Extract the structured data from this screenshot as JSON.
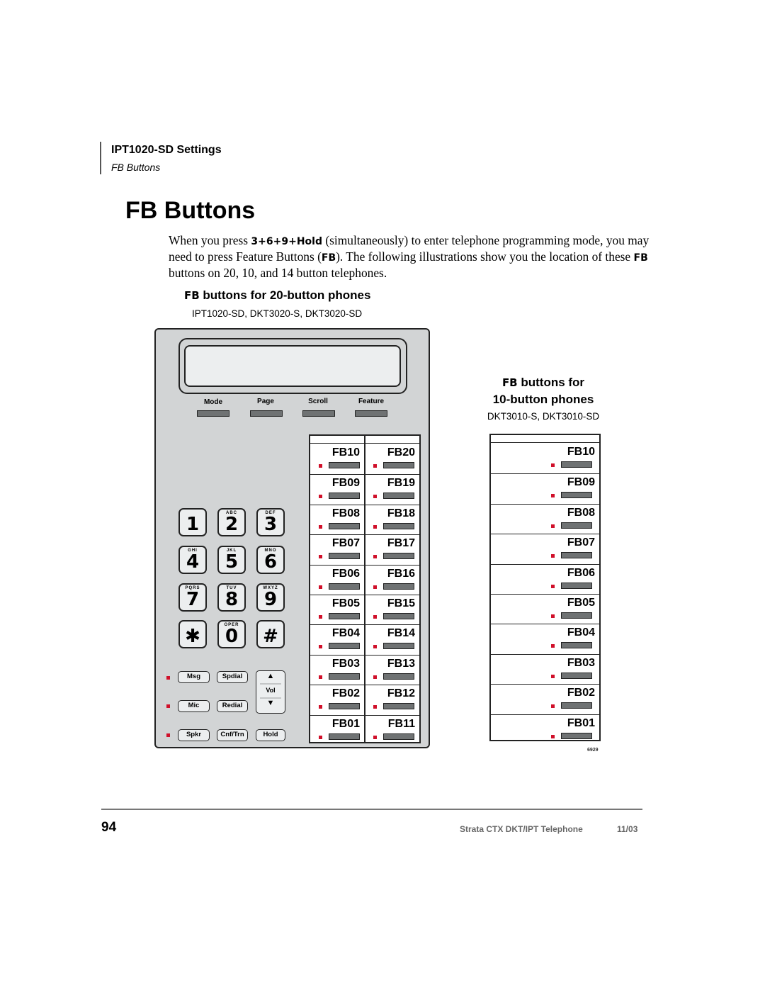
{
  "header": {
    "section": "IPT1020-SD Settings",
    "subsection": "FB Buttons"
  },
  "title": "FB Buttons",
  "body": {
    "p1_a": "When you press ",
    "p1_keys": "3+6+9+Hold",
    "p1_b": " (simultaneously) to enter telephone programming mode, you may need to press Feature Buttons (",
    "p1_fb": "FB",
    "p1_c": "). The following illustrations show you the location of these ",
    "p1_fb2": "FB",
    "p1_d": " buttons on 20, 10, and 14 button telephones."
  },
  "figure20": {
    "heading_fb": "FB",
    "heading_rest": " buttons for 20-button phones",
    "models": "IPT1020-SD, DKT3020-S, DKT3020-SD",
    "soft_keys": [
      "Mode",
      "Page",
      "Scroll",
      "Feature"
    ],
    "keypad": [
      {
        "digit": "1",
        "letters": ""
      },
      {
        "digit": "2",
        "letters": "ABC"
      },
      {
        "digit": "3",
        "letters": "DEF"
      },
      {
        "digit": "4",
        "letters": "GHI"
      },
      {
        "digit": "5",
        "letters": "JKL"
      },
      {
        "digit": "6",
        "letters": "MNO"
      },
      {
        "digit": "7",
        "letters": "PQRS"
      },
      {
        "digit": "8",
        "letters": "TUV"
      },
      {
        "digit": "9",
        "letters": "WXYZ"
      },
      {
        "digit": "✱",
        "letters": ""
      },
      {
        "digit": "0",
        "letters": "OPER"
      },
      {
        "digit": "#",
        "letters": ""
      }
    ],
    "function_keys": {
      "msg": "Msg",
      "spdial": "Spdial",
      "mic": "Mic",
      "redial": "Redial",
      "spkr": "Spkr",
      "cnftrn": "Cnf/Trn",
      "hold": "Hold",
      "vol": "Vol",
      "vol_up": "▲",
      "vol_down": "▼"
    },
    "fb_left": [
      "FB10",
      "FB09",
      "FB08",
      "FB07",
      "FB06",
      "FB05",
      "FB04",
      "FB03",
      "FB02",
      "FB01"
    ],
    "fb_right": [
      "FB20",
      "FB19",
      "FB18",
      "FB17",
      "FB16",
      "FB15",
      "FB14",
      "FB13",
      "FB12",
      "FB11"
    ]
  },
  "figure10": {
    "heading_fb": "FB",
    "heading_rest": " buttons for",
    "heading_line2": "10-button phones",
    "models": "DKT3010-S, DKT3010-SD",
    "fb": [
      "FB10",
      "FB09",
      "FB08",
      "FB07",
      "FB06",
      "FB05",
      "FB04",
      "FB03",
      "FB02",
      "FB01"
    ],
    "figure_id": "6929"
  },
  "footer": {
    "page_number": "94",
    "book_title": "Strata CTX DKT/IPT Telephone",
    "date": "11/03"
  },
  "colors": {
    "led_red": "#d0102a",
    "phone_body": "#d2d4d5",
    "key_face": "#eceeef",
    "button_bar": "#6f7273"
  }
}
